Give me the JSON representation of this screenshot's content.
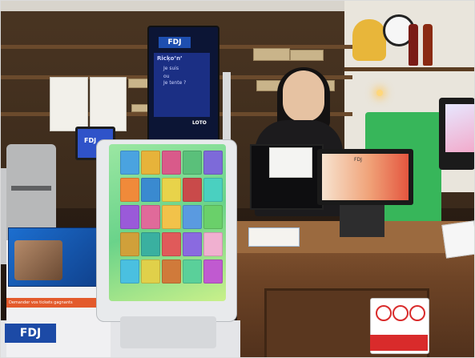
{
  "scene": {
    "description_colors": {
      "wood": "#6b4a2c",
      "fdj_blue": "#1e4fb0",
      "screen_green": "#6ad38a"
    }
  },
  "sign": {
    "logo": "FDJ",
    "line1": "Ricķo’n’",
    "line2": "Je suis",
    "line3": "ou",
    "line4": "Je tente ?",
    "bottom": "LOTO"
  },
  "bottom_logo": "FDJ",
  "strip_text": "Demander vos tickets gagnants",
  "small_screen_text": "FDJ",
  "pos_text": "FDJ"
}
